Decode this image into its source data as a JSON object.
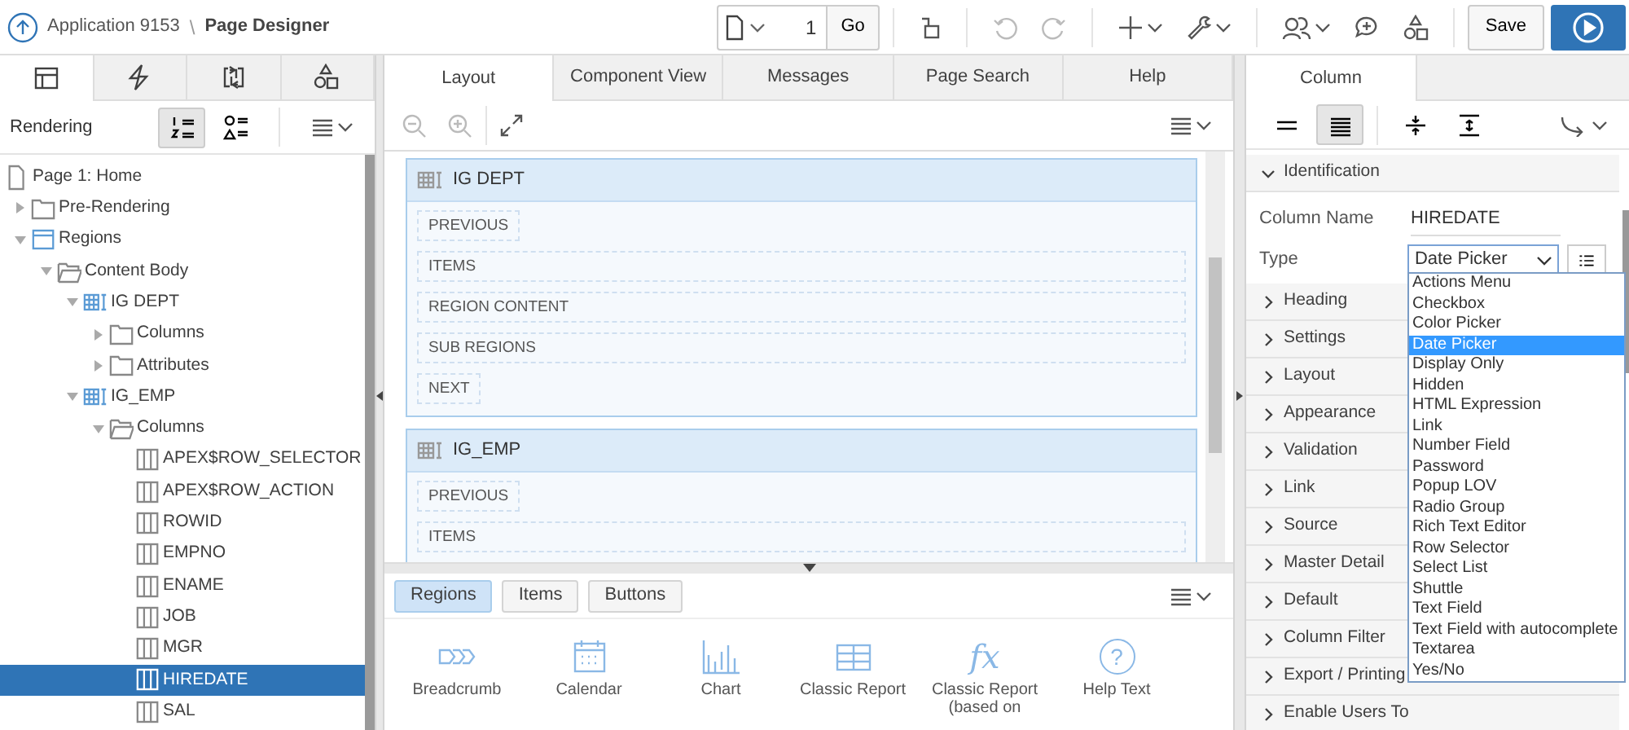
{
  "header": {
    "app": "Application 9153",
    "separator": "\\",
    "title": "Page Designer"
  },
  "toolbar": {
    "page_number": "1",
    "go": "Go",
    "undo_disabled": true,
    "redo_disabled": true,
    "save": "Save"
  },
  "left_tabs": [
    {
      "kind": "rendering",
      "selected": true
    },
    {
      "kind": "dynamic",
      "selected": false
    },
    {
      "kind": "processing",
      "selected": false
    },
    {
      "kind": "shared",
      "selected": false
    }
  ],
  "left_toolbar": {
    "title": "Rendering",
    "views": [
      {
        "kind": "ordered",
        "selected": true
      },
      {
        "kind": "grouped",
        "selected": false
      }
    ]
  },
  "tree": [
    {
      "label": "Page 1: Home",
      "kind": "page",
      "selected": false,
      "children": [
        {
          "label": "Pre-Rendering",
          "kind": "folder",
          "expanded": false,
          "selected": false
        },
        {
          "label": "Regions",
          "kind": "region",
          "expanded": true,
          "selected": false,
          "children": [
            {
              "label": "Content Body",
              "kind": "folder",
              "expanded": true,
              "selected": false,
              "children": [
                {
                  "label": "IG DEPT",
                  "kind": "grid",
                  "expanded": true,
                  "selected": false,
                  "children": [
                    {
                      "label": "Columns",
                      "kind": "folder",
                      "expanded": false,
                      "selected": false
                    },
                    {
                      "label": "Attributes",
                      "kind": "folder",
                      "expanded": false,
                      "selected": false
                    }
                  ]
                },
                {
                  "label": "IG_EMP",
                  "kind": "grid",
                  "expanded": true,
                  "selected": false,
                  "children": [
                    {
                      "label": "Columns",
                      "kind": "folder",
                      "expanded": true,
                      "selected": false,
                      "children": [
                        {
                          "label": "APEX$ROW_SELECTOR",
                          "kind": "column",
                          "selected": false
                        },
                        {
                          "label": "APEX$ROW_ACTION",
                          "kind": "column",
                          "selected": false
                        },
                        {
                          "label": "ROWID",
                          "kind": "column",
                          "selected": false
                        },
                        {
                          "label": "EMPNO",
                          "kind": "column",
                          "selected": false
                        },
                        {
                          "label": "ENAME",
                          "kind": "column",
                          "selected": false
                        },
                        {
                          "label": "JOB",
                          "kind": "column",
                          "selected": false
                        },
                        {
                          "label": "MGR",
                          "kind": "column",
                          "selected": false
                        },
                        {
                          "label": "HIREDATE",
                          "kind": "column",
                          "selected": true
                        },
                        {
                          "label": "SAL",
                          "kind": "column",
                          "selected": false
                        }
                      ]
                    }
                  ]
                }
              ]
            }
          ]
        }
      ]
    }
  ],
  "center_tabs": [
    {
      "label": "Layout",
      "selected": true
    },
    {
      "label": "Component View",
      "selected": false
    },
    {
      "label": "Messages",
      "selected": false
    },
    {
      "label": "Page Search",
      "selected": false
    },
    {
      "label": "Help",
      "selected": false
    }
  ],
  "regions": [
    {
      "title": "IG DEPT",
      "slots": [
        {
          "label": "PREVIOUS",
          "wide": false
        },
        {
          "label": "ITEMS",
          "wide": true
        },
        {
          "label": "REGION CONTENT",
          "wide": true
        },
        {
          "label": "SUB REGIONS",
          "wide": true
        },
        {
          "label": "NEXT",
          "wide": false
        }
      ]
    },
    {
      "title": "IG_EMP",
      "slots": [
        {
          "label": "PREVIOUS",
          "wide": false
        },
        {
          "label": "ITEMS",
          "wide": true
        }
      ]
    }
  ],
  "gallery_tabs": [
    {
      "label": "Regions",
      "selected": true
    },
    {
      "label": "Items",
      "selected": false
    },
    {
      "label": "Buttons",
      "selected": false
    }
  ],
  "gallery": [
    {
      "label": "Breadcrumb",
      "kind": "breadcrumb"
    },
    {
      "label": "Calendar",
      "kind": "calendar"
    },
    {
      "label": "Chart",
      "kind": "chart"
    },
    {
      "label": "Classic Report",
      "kind": "table"
    },
    {
      "label": "Classic Report (based on",
      "kind": "function",
      "glyph": "fx"
    },
    {
      "label": "Help Text",
      "kind": "help",
      "glyph": "?"
    }
  ],
  "right_tabs": [
    {
      "label": "Column",
      "selected": true
    }
  ],
  "right_toolbar": {
    "views": [
      {
        "kind": "normal",
        "selected": false
      },
      {
        "kind": "dense",
        "selected": true
      }
    ]
  },
  "property_groups": [
    {
      "label": "Identification",
      "expanded": true,
      "fields": [
        {
          "label": "Column Name",
          "kind": "display",
          "value": "HIREDATE"
        },
        {
          "label": "Type",
          "kind": "select",
          "value": "Date Picker"
        }
      ]
    },
    {
      "label": "Heading",
      "expanded": false
    },
    {
      "label": "Settings",
      "expanded": false
    },
    {
      "label": "Layout",
      "expanded": false
    },
    {
      "label": "Appearance",
      "expanded": false
    },
    {
      "label": "Validation",
      "expanded": false
    },
    {
      "label": "Link",
      "expanded": false
    },
    {
      "label": "Source",
      "expanded": false
    },
    {
      "label": "Master Detail",
      "expanded": false
    },
    {
      "label": "Default",
      "expanded": false
    },
    {
      "label": "Column Filter",
      "expanded": false
    },
    {
      "label": "Export / Printing",
      "expanded": false
    },
    {
      "label": "Enable Users To",
      "expanded": false
    }
  ],
  "type_dropdown": {
    "options": [
      {
        "label": "Actions Menu",
        "selected": false
      },
      {
        "label": "Checkbox",
        "selected": false
      },
      {
        "label": "Color Picker",
        "selected": false
      },
      {
        "label": "Date Picker",
        "selected": true
      },
      {
        "label": "Display Only",
        "selected": false
      },
      {
        "label": "Hidden",
        "selected": false
      },
      {
        "label": "HTML Expression",
        "selected": false
      },
      {
        "label": "Link",
        "selected": false
      },
      {
        "label": "Number Field",
        "selected": false
      },
      {
        "label": "Password",
        "selected": false
      },
      {
        "label": "Popup LOV",
        "selected": false
      },
      {
        "label": "Radio Group",
        "selected": false
      },
      {
        "label": "Rich Text Editor",
        "selected": false
      },
      {
        "label": "Row Selector",
        "selected": false
      },
      {
        "label": "Select List",
        "selected": false
      },
      {
        "label": "Shuttle",
        "selected": false
      },
      {
        "label": "Text Field",
        "selected": false
      },
      {
        "label": "Text Field with autocomplete",
        "selected": false
      },
      {
        "label": "Textarea",
        "selected": false
      },
      {
        "label": "Yes/No",
        "selected": false
      }
    ]
  }
}
